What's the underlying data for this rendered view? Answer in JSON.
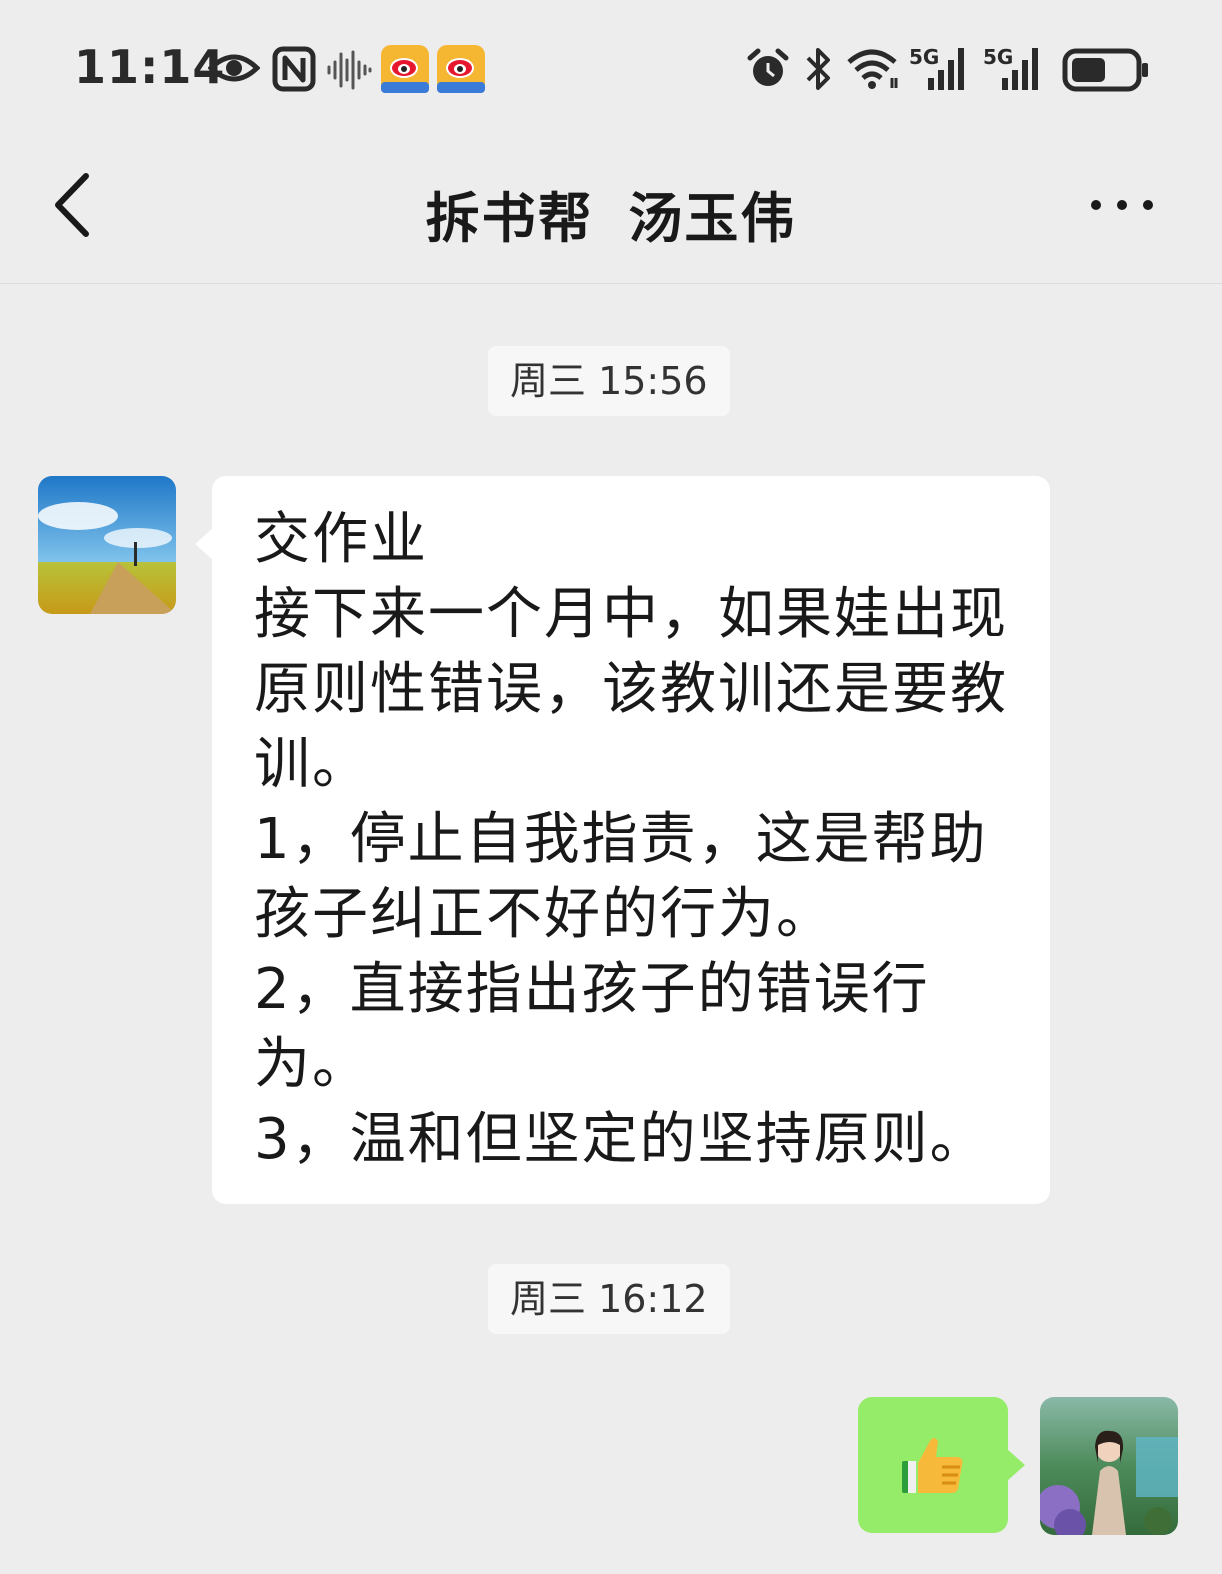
{
  "status_bar": {
    "time": "11:14",
    "icons": [
      "eye-icon",
      "nfc-icon",
      "audio-wave-icon",
      "weibo-app-icon",
      "weibo-app-icon",
      "alarm-icon",
      "bluetooth-icon",
      "wifi-icon",
      "signal-5g-icon",
      "signal-5g-icon",
      "battery-icon"
    ],
    "network_label_1": "5G",
    "network_label_2": "5G",
    "battery_level": 0.55
  },
  "header": {
    "title": "拆书帮  汤玉伟",
    "back_icon": "chevron-left-icon",
    "more_icon": "more-dots-icon"
  },
  "messages": [
    {
      "timestamp": "周三 15:56",
      "sender": "other",
      "text": "交作业\n接下来一个月中，如果娃出现原则性错误，该教训还是要教训。\n1，停止自我指责，这是帮助孩子纠正不好的行为。\n2，直接指出孩子的错误行为。\n3，温和但坚定的坚持原则。"
    },
    {
      "timestamp": "周三 16:12",
      "sender": "me",
      "emoji": "👍"
    }
  ],
  "colors": {
    "background": "#ededed",
    "incoming_bubble": "#ffffff",
    "outgoing_bubble": "#95ec69",
    "timestamp_bg": "#f7f7f7"
  }
}
